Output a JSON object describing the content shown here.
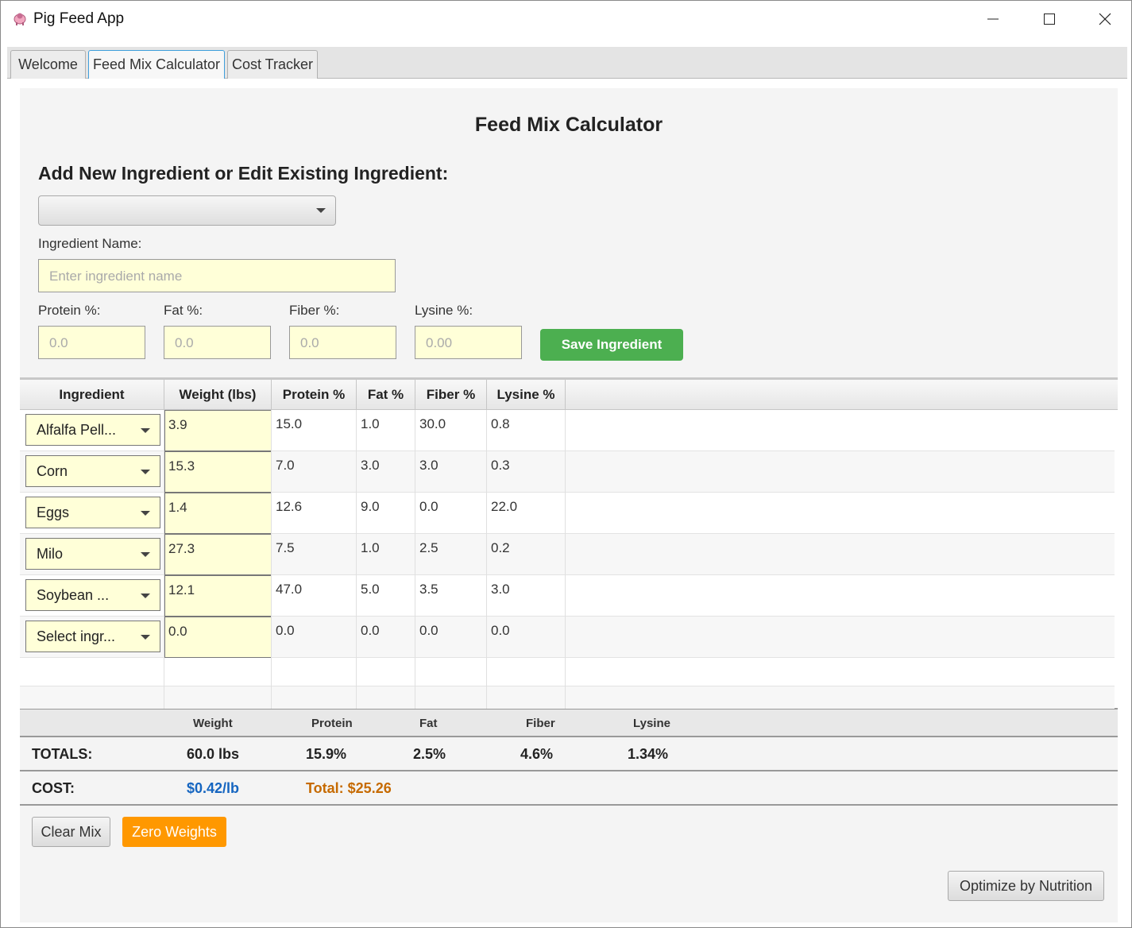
{
  "window": {
    "title": "Pig Feed App",
    "icon": "pig-icon"
  },
  "tabs": [
    {
      "label": "Welcome"
    },
    {
      "label": "Feed Mix Calculator",
      "active": true
    },
    {
      "label": "Cost Tracker"
    }
  ],
  "page": {
    "title": "Feed Mix Calculator",
    "section_title": "Add New Ingredient or Edit Existing Ingredient:",
    "ingredient_select_value": ""
  },
  "form": {
    "name_label": "Ingredient Name:",
    "name_placeholder": "Enter ingredient name",
    "protein_label": "Protein %:",
    "protein_placeholder": "0.0",
    "fat_label": "Fat %:",
    "fat_placeholder": "0.0",
    "fiber_label": "Fiber %:",
    "fiber_placeholder": "0.0",
    "lysine_label": "Lysine %:",
    "lysine_placeholder": "0.00",
    "save_label": "Save Ingredient"
  },
  "table": {
    "headers": [
      "Ingredient",
      "Weight (lbs)",
      "Protein %",
      "Fat %",
      "Fiber %",
      "Lysine %"
    ],
    "rows": [
      {
        "ingredient": "Alfalfa Pell...",
        "weight": "3.9",
        "protein": "15.0",
        "fat": "1.0",
        "fiber": "30.0",
        "lysine": "0.8"
      },
      {
        "ingredient": "Corn",
        "weight": "15.3",
        "protein": "7.0",
        "fat": "3.0",
        "fiber": "3.0",
        "lysine": "0.3"
      },
      {
        "ingredient": "Eggs",
        "weight": "1.4",
        "protein": "12.6",
        "fat": "9.0",
        "fiber": "0.0",
        "lysine": "22.0"
      },
      {
        "ingredient": "Milo",
        "weight": "27.3",
        "protein": "7.5",
        "fat": "1.0",
        "fiber": "2.5",
        "lysine": "0.2"
      },
      {
        "ingredient": "Soybean ...",
        "weight": "12.1",
        "protein": "47.0",
        "fat": "5.0",
        "fiber": "3.5",
        "lysine": "3.0"
      },
      {
        "ingredient": "Select ingr...",
        "weight": "0.0",
        "protein": "0.0",
        "fat": "0.0",
        "fiber": "0.0",
        "lysine": "0.0"
      }
    ]
  },
  "summary": {
    "headers": {
      "weight": "Weight",
      "protein": "Protein",
      "fat": "Fat",
      "fiber": "Fiber",
      "lysine": "Lysine"
    },
    "totals": {
      "label": "TOTALS:",
      "weight": "60.0 lbs",
      "protein": "15.9%",
      "fat": "2.5%",
      "fiber": "4.6%",
      "lysine": "1.34%"
    },
    "cost": {
      "label": "COST:",
      "per_lb": "$0.42/lb",
      "total": "Total: $25.26"
    }
  },
  "buttons": {
    "clear_mix": "Clear Mix",
    "zero_weights": "Zero Weights",
    "optimize": "Optimize by Nutrition"
  },
  "colors": {
    "save_button": "#4caf50",
    "zero_button": "#ff9800",
    "cost_per_lb": "#1565c0",
    "cost_total": "#c66a00",
    "input_fill": "#ffffd8",
    "active_tab_border": "#3f9fdc"
  }
}
